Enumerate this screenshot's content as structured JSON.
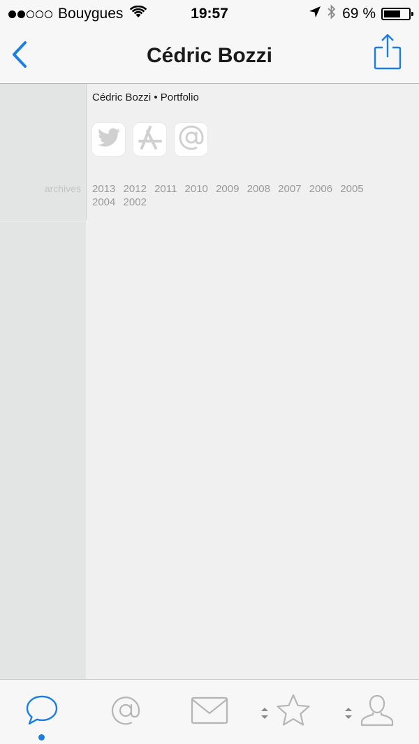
{
  "status_bar": {
    "carrier": "Bouygues",
    "time": "19:57",
    "battery": "69 %",
    "battery_level": 0.69,
    "signal_bars_filled": 2,
    "signal_bars_total": 5
  },
  "nav": {
    "title": "Cédric Bozzi",
    "back_icon": "chevron-left-icon",
    "share_icon": "share-icon"
  },
  "content": {
    "portfolio_title": "Cédric Bozzi • Portfolio",
    "social": [
      {
        "icon": "twitter-icon"
      },
      {
        "icon": "app-store-icon"
      },
      {
        "icon": "at-icon"
      }
    ],
    "archives_label": "archives",
    "years": [
      "2013",
      "2012",
      "2011",
      "2010",
      "2009",
      "2008",
      "2007",
      "2006",
      "2005",
      "2004",
      "2002"
    ]
  },
  "tab_bar": {
    "tabs": [
      {
        "icon": "speech-bubble-icon",
        "active": true
      },
      {
        "icon": "at-icon",
        "active": false
      },
      {
        "icon": "envelope-icon",
        "active": false
      },
      {
        "icon": "star-icon",
        "active": false
      },
      {
        "icon": "person-icon",
        "active": false
      }
    ]
  },
  "colors": {
    "accent": "#1a7fe0",
    "sidebar": "#e3e5e4",
    "background": "#f0f0f0",
    "icon_gray": "#b5b5b5"
  }
}
